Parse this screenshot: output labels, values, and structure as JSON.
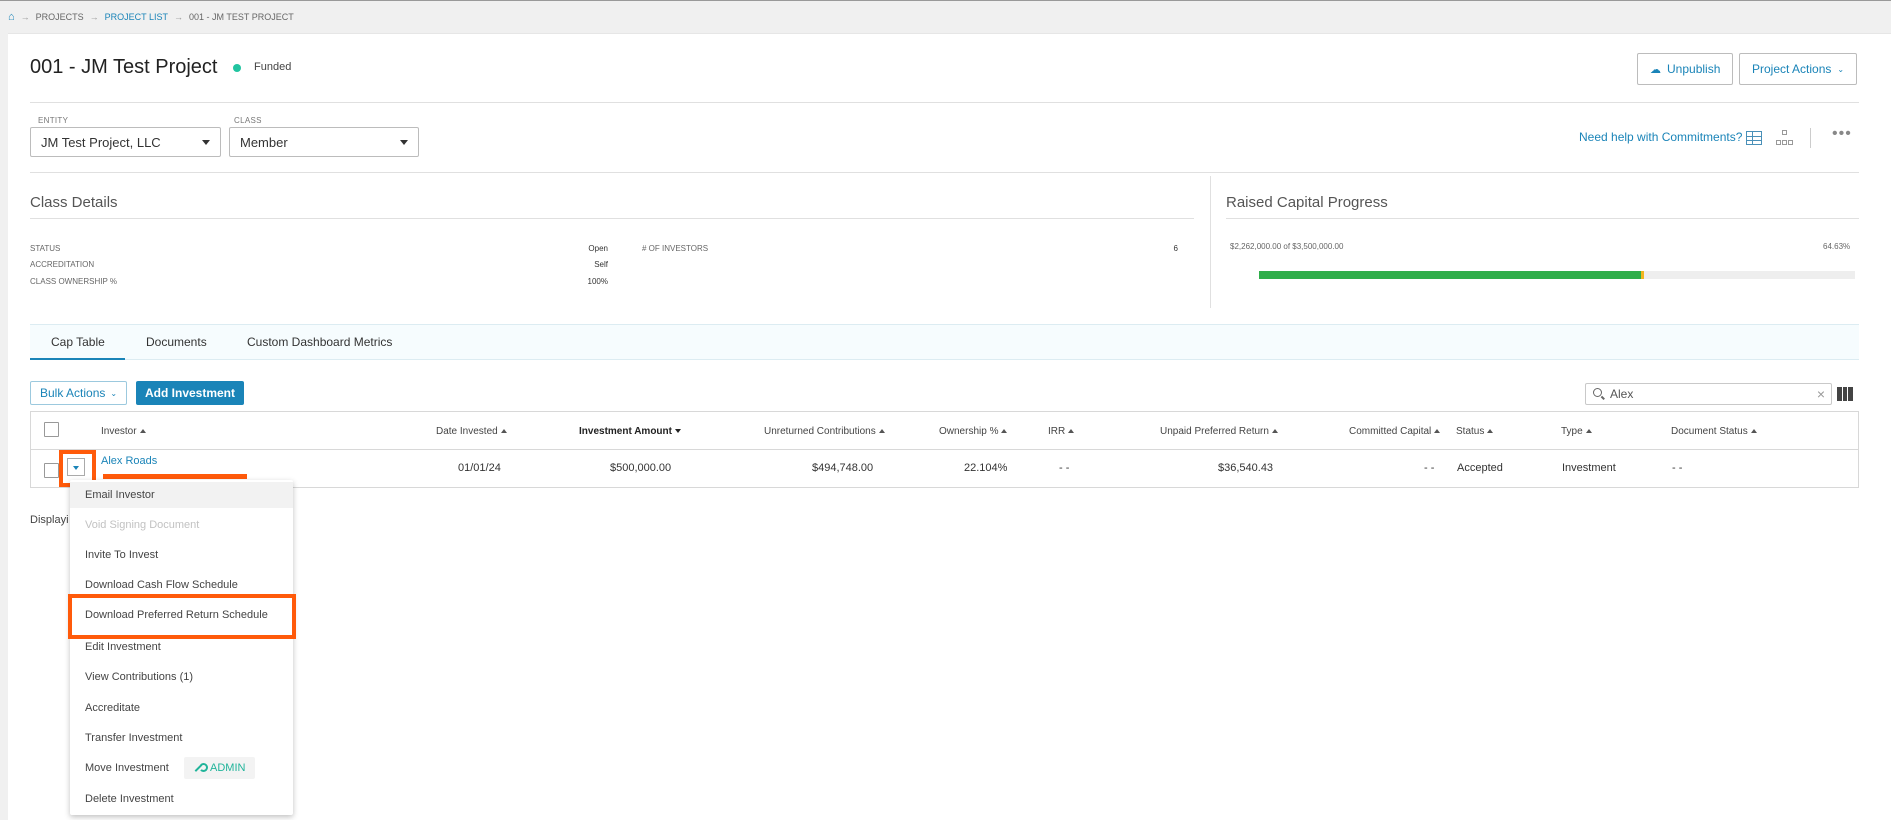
{
  "breadcrumb": {
    "items": [
      "PROJECTS",
      "PROJECT LIST",
      "001 - JM TEST PROJECT"
    ]
  },
  "header": {
    "title": "001 - JM Test Project",
    "status": "Funded",
    "status_color": "#21c4a0",
    "unpublish_label": "Unpublish",
    "project_actions_label": "Project Actions"
  },
  "filters": {
    "entity_label": "ENTITY",
    "entity_value": "JM Test Project, LLC",
    "class_label": "CLASS",
    "class_value": "Member",
    "help_link": "Need help with Commitments?"
  },
  "class_details": {
    "title": "Class Details",
    "rows": [
      {
        "label": "STATUS",
        "value": "Open"
      },
      {
        "label": "ACCREDITATION",
        "value": "Self"
      },
      {
        "label": "CLASS OWNERSHIP %",
        "value": "100%"
      }
    ],
    "investors_label": "# OF INVESTORS",
    "investors_value": "6"
  },
  "raised_capital": {
    "title": "Raised Capital Progress",
    "amount_text": "$2,262,000.00 of $3,500,000.00",
    "percent_text": "64.63%",
    "progress_fraction": 0.6463
  },
  "tabs": [
    {
      "label": "Cap Table",
      "active": true
    },
    {
      "label": "Documents",
      "active": false
    },
    {
      "label": "Custom Dashboard Metrics",
      "active": false
    }
  ],
  "toolbar": {
    "bulk_actions_label": "Bulk Actions",
    "add_investment_label": "Add Investment",
    "search_value": "Alex"
  },
  "table": {
    "columns": [
      "Investor",
      "Date Invested",
      "Investment Amount",
      "Unreturned Contributions",
      "Ownership %",
      "IRR",
      "Unpaid Preferred Return",
      "Committed Capital",
      "Status",
      "Type",
      "Document Status"
    ],
    "row": {
      "investor": "Alex Roads",
      "date_invested": "01/01/24",
      "investment_amount": "$500,000.00",
      "unreturned_contributions": "$494,748.00",
      "ownership": "22.104%",
      "irr": "- -",
      "unpaid_preferred_return": "$36,540.43",
      "committed_capital": "- -",
      "status": "Accepted",
      "type": "Investment",
      "document_status": "- -"
    },
    "footer_text": "Displayi"
  },
  "row_menu": {
    "items": [
      "Email Investor",
      "Void Signing Document",
      "Invite To Invest",
      "Download Cash Flow Schedule",
      "Download Preferred Return Schedule",
      "Edit Investment",
      "View Contributions (1)",
      "Accreditate",
      "Transfer Investment",
      "Move Investment",
      "Delete Investment"
    ],
    "admin_badge": "ADMIN"
  },
  "colors": {
    "accent": "#1a84b8",
    "highlight": "#ff5a0a",
    "progress": "#2fae4a"
  }
}
